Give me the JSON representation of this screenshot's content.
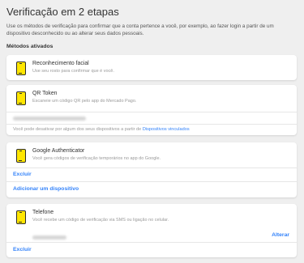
{
  "page": {
    "title": "Verificação em 2 etapas",
    "intro": "Use os métodos de verificação para confirmar que a conta pertence a você, por exemplo, ao fazer login a partir de um dispositivo desconhecido ou ao alterar seus dados pessoais.",
    "section_title": "Métodos ativados"
  },
  "methods": {
    "face": {
      "name": "Reconhecimento facial",
      "desc": "Use seu rosto para confirmar que é você."
    },
    "qr": {
      "name": "QR Token",
      "desc": "Escaneie um código QR pelo app do Mercado Pago.",
      "note_prefix": "Você pode desativar por algum dos seus dispositivos a partir de ",
      "note_link": "Dispositivos vinculados"
    },
    "google": {
      "name": "Google Authenticator",
      "desc": "Você gera códigos de verificação temporários no app do Google.",
      "delete": "Excluir",
      "add_device": "Adicionar um dispositivo"
    },
    "phone": {
      "name": "Telefone",
      "desc": "Você recebe um código de verificação via SMS ou ligação no celular.",
      "change": "Alterar",
      "delete": "Excluir"
    }
  },
  "colors": {
    "accent": "#3483fa",
    "icon_fill": "#ffe600",
    "background": "#efefef"
  }
}
